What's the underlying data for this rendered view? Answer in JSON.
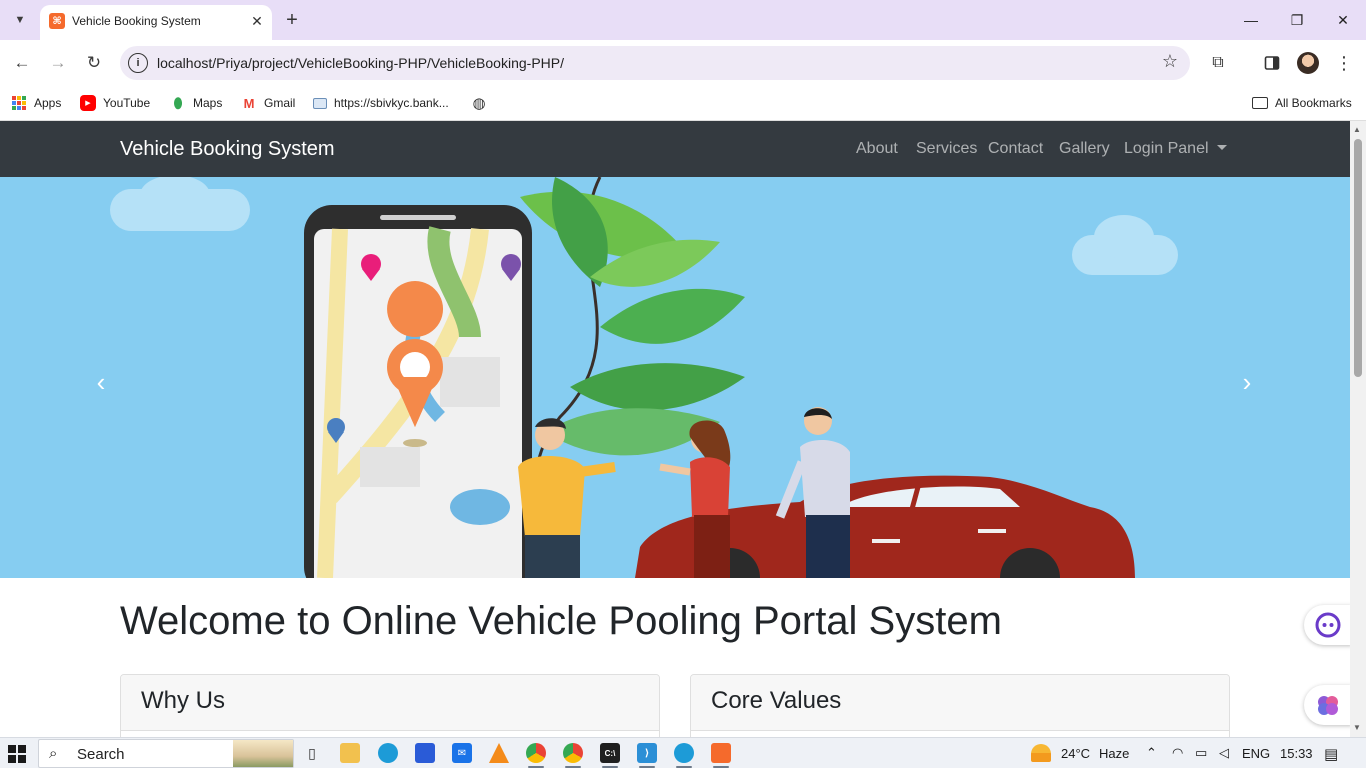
{
  "browser": {
    "tab": {
      "title": "Vehicle Booking System",
      "close": "✕"
    },
    "new_tab": "+",
    "window_controls": {
      "minimize": "—",
      "restore": "❐",
      "close": "✕"
    },
    "nav": {
      "back": "←",
      "forward": "→",
      "reload": "↻"
    },
    "url": "localhost/Priya/project/VehicleBooking-PHP/VehicleBooking-PHP/",
    "bookmarks": [
      {
        "label": "Apps",
        "icon": "apps-grid-icon"
      },
      {
        "label": "YouTube",
        "icon": "youtube-icon"
      },
      {
        "label": "Maps",
        "icon": "maps-icon"
      },
      {
        "label": "Gmail",
        "icon": "gmail-icon"
      },
      {
        "label": "https://sbivkyc.bank...",
        "icon": "bank-icon"
      },
      {
        "label": "",
        "icon": "globe-icon"
      }
    ],
    "all_bookmarks": "All Bookmarks"
  },
  "site": {
    "brand": "Vehicle Booking System",
    "nav": [
      "About",
      "Services",
      "Contact",
      "Gallery",
      "Login Panel"
    ],
    "carousel": {
      "prev": "‹",
      "next": "›",
      "colors": {
        "sky": "#86cdf1",
        "car": "#a0271c",
        "leaf": "#4caf50"
      }
    },
    "welcome": "Welcome to Online Vehicle Pooling Portal System",
    "cards": [
      {
        "title": "Why Us"
      },
      {
        "title": "Core Values"
      }
    ]
  },
  "taskbar": {
    "search": "Search",
    "weather": {
      "temp": "24°C",
      "condition": "Haze"
    },
    "language": "ENG",
    "time": "15:33"
  }
}
